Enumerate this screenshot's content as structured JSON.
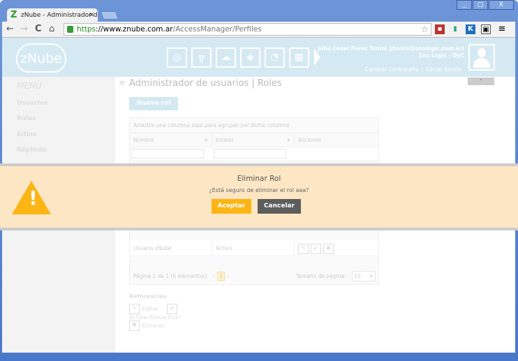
{
  "browser": {
    "tab_title": "zNube - Administrador de usuarios",
    "url_scheme": "https",
    "url_host": "://www.znube.com.ar",
    "url_path": "/AccessManager/Perfiles"
  },
  "header": {
    "logo": "zNube",
    "user_name": "Julio Cesar Perez Tonini (jtonini@zoologic.com.ar)",
    "company": "Zoo Logic - DyC",
    "change_password": "Cambiar Contraseña",
    "logout": "Cerrar Sesión",
    "app_icons": [
      "users-circle-icon",
      "tree-icon",
      "cloud-gear-icon",
      "cube-icon",
      "clock-icon",
      "gift-icon"
    ]
  },
  "sidebar": {
    "title": "MENÚ",
    "items": [
      {
        "label": "Usuarios"
      },
      {
        "label": "Roles"
      },
      {
        "label": "Sitios"
      },
      {
        "label": "Réplicas"
      }
    ]
  },
  "main": {
    "title": "Administrador de usuarios | Roles",
    "new_button": "Nuevo rol",
    "grid": {
      "group_hint": "Arrastre una columna aquí para agrupar por dicha columna",
      "columns": [
        "Nombre",
        "Estado",
        "Acciones"
      ],
      "rows": [
        {
          "name": "Usuario zNube",
          "status": "Activo"
        }
      ],
      "pager": {
        "summary": "Página 1 de 1 (6 elementos)",
        "current_page": "1",
        "page_size_label": "Tamaño de página:",
        "page_size": "10"
      }
    },
    "references": {
      "title": "Referencias",
      "edit": "Editar",
      "toggle": "Activar/Desactivar",
      "delete": "Eliminar"
    }
  },
  "modal": {
    "title": "Eliminar Rol",
    "message": "¿Está seguro de eliminar el rol aaa?",
    "accept": "Aceptar",
    "cancel": "Cancelar"
  },
  "colors": {
    "accent": "#fdb515",
    "header": "#d5e9f3",
    "modal_bg": "#fde6c4",
    "cancel": "#5d5d5d"
  }
}
